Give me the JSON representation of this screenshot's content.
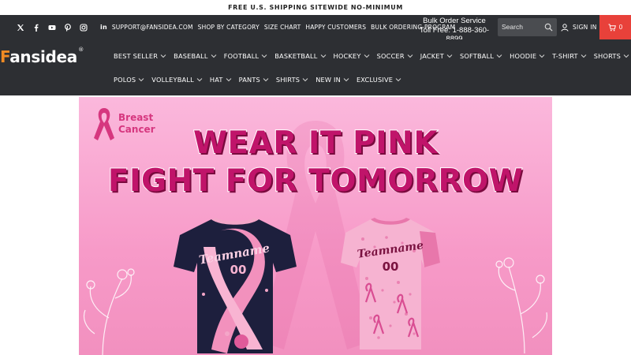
{
  "announcement": "FREE U.S. SHIPPING SITEWIDE NO-MINIMUM",
  "social_icons": [
    "x-icon",
    "facebook-icon",
    "youtube-icon",
    "pinterest-icon",
    "instagram-icon"
  ],
  "top_links": {
    "email": "SUPPORT@FANSIDEA.COM",
    "shop_by_category": "SHOP BY CATEGORY",
    "size_chart": "SIZE CHART",
    "happy_customers": "HAPPY CUSTOMERS",
    "bulk_ordering": "BULK ORDERING PROGRAM"
  },
  "bulk_service": {
    "title": "Bulk Order Service",
    "phone": "Toll Free: 1-888-360-8899"
  },
  "search": {
    "placeholder": "Search"
  },
  "account": {
    "sign_in": "SIGN IN"
  },
  "cart": {
    "count": "0"
  },
  "logo": {
    "first": "F",
    "rest": "ansidea",
    "reg": "®"
  },
  "nav": {
    "row1": [
      "BEST SELLER",
      "BASEBALL",
      "FOOTBALL",
      "BASKETBALL",
      "HOCKEY",
      "SOCCER",
      "JACKET",
      "SOFTBALL",
      "HOODIE",
      "T-SHIRT",
      "SHORTS"
    ],
    "row2": [
      "POLOS",
      "VOLLEYBALL",
      "HAT",
      "PANTS",
      "SHIRTS",
      "NEW IN",
      "EXCLUSIVE"
    ]
  },
  "banner": {
    "badge_line1": "Breast",
    "badge_line2": "Cancer",
    "headline1": "WEAR IT PINK",
    "headline2": "FIGHT FOR TOMORROW",
    "jersey_left_name": "Teamname",
    "jersey_left_number": "00",
    "jersey_right_name": "Teamname",
    "jersey_right_number": "00"
  },
  "colors": {
    "topbar": "#2d2f33",
    "cart_accent": "#e8413a",
    "logo_orange": "#f08a24",
    "banner_pink": "#f79ac8",
    "headline_magenta": "#c0146a"
  }
}
